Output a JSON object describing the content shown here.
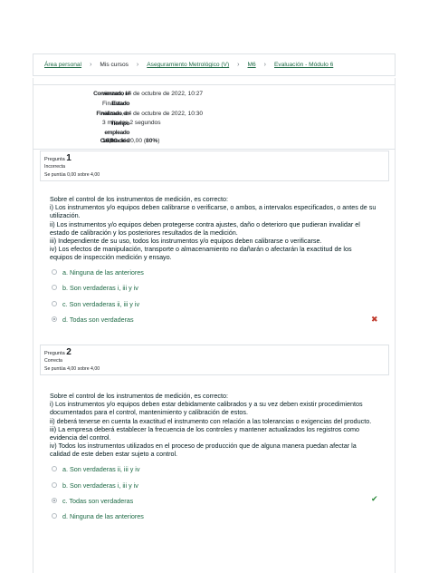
{
  "breadcrumb": {
    "items": [
      {
        "label": "Área personal",
        "link": true
      },
      {
        "label": "Mis cursos",
        "link": false
      },
      {
        "label": "Aseguramiento Metrológico (V)",
        "link": true
      },
      {
        "label": "M6",
        "link": true
      },
      {
        "label": "Evaluación - Módulo 6",
        "link": true
      }
    ],
    "separator": "›"
  },
  "summary": {
    "started_label": "Comenzado el",
    "started_value": "viernes, 14 de octubre de 2022, 10:27",
    "state_label": "Estado",
    "state_value": "Finalizado",
    "finished_label": "Finalizado en",
    "finished_value": "viernes, 14 de octubre de 2022, 10:30",
    "time_label_1": "Tiempo",
    "time_label_2": "empleado",
    "time_value": "3 minutos 2 segundos",
    "grade_label": "Calificación",
    "grade_score": "16,00",
    "grade_rest": " de 20,00 (",
    "grade_percent": "80%",
    "grade_close": ")"
  },
  "questions": [
    {
      "title": "Pregunta",
      "number": "1",
      "state": "Incorrecta",
      "grade": "Se puntúa 0,00 sobre 4,00",
      "lines": [
        "Sobre el control de los instrumentos de medición, es correcto:",
        "i) Los instrumentos y/o equipos deben calibrarse o verificarse, o ambos, a intervalos especificados, o antes de su",
        "utilización.",
        "ii) Los instrumentos y/o equipos deben protegerse contra ajustes, daño o deterioro que pudieran invalidar el",
        "estado de calibración y los posteriores resultados de la medición.",
        "iii) Independiente de su uso, todos los instrumentos y/o equipos deben calibrarse o verificarse.",
        "iv) Los efectos de manipulación, transporte o almacenamiento no dañarán o afectarán la exactitud de los",
        "equipos de inspección medición y ensayo."
      ],
      "options": [
        {
          "label": "a. Ninguna de las anteriores",
          "checked": false
        },
        {
          "label": "b. Son verdaderas i, iii y iv",
          "checked": false
        },
        {
          "label": "c. Son verdaderas ii, iii y iv",
          "checked": false
        },
        {
          "label": "d. Todas son verdaderas",
          "checked": true
        }
      ],
      "feedback_icon": "incorrect-x-icon",
      "feedback_glyph": "✖"
    },
    {
      "title": "Pregunta",
      "number": "2",
      "state": "Correcta",
      "grade": "Se puntúa 4,00 sobre 4,00",
      "lines": [
        "Sobre el control de los instrumentos de medición, es correcto:",
        "i) Los instrumentos y/o equipos deben estar debidamente calibrados y a su vez deben existir procedimientos",
        "documentados para el control, mantenimiento y calibración de estos.",
        "ii) deberá tenerse en cuenta la exactitud el instrumento con relación a las tolerancias o exigencias del producto.",
        "iii) La empresa deberá establecer la frecuencia de los controles y mantener actualizados los registros como",
        "evidencia del control.",
        "iv) Todos los instrumentos utilizados en el proceso de producción que de alguna manera puedan afectar la",
        "calidad de este deben estar sujeto a control."
      ],
      "options": [
        {
          "label": "a. Son verdaderas ii, iii y iv",
          "checked": false
        },
        {
          "label": "b. Son verdaderas i, iii y iv",
          "checked": false
        },
        {
          "label": "c. Todas son verdaderas",
          "checked": true
        },
        {
          "label": "d. Ninguna de las anteriores",
          "checked": false
        }
      ],
      "feedback_icon": "correct-check-icon",
      "feedback_glyph": "✔"
    }
  ]
}
